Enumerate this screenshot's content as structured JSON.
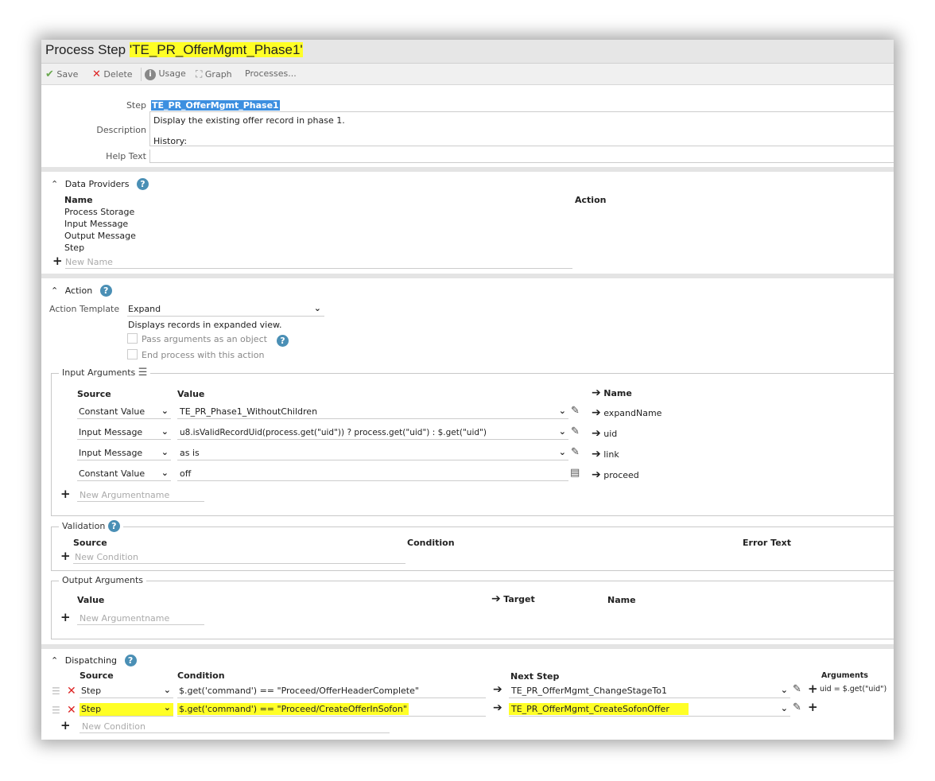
{
  "title": {
    "prefix": "Process Step",
    "name": "'TE_PR_OfferMgmt_Phase1'"
  },
  "toolbar": {
    "save": "Save",
    "delete": "Delete",
    "usage": "Usage",
    "graph": "Graph",
    "processes": "Processes..."
  },
  "step": {
    "step_label": "Step",
    "step_value": "TE_PR_OfferMgmt_Phase1",
    "description_label": "Description",
    "description_line1": "Display the existing offer record in phase 1.",
    "description_line2": "History:",
    "help_label": "Help Text"
  },
  "data_providers": {
    "title": "Data Providers",
    "col_name": "Name",
    "col_action": "Action",
    "items": [
      "Process Storage",
      "Input Message",
      "Output Message",
      "Step"
    ],
    "new_placeholder": "New Name"
  },
  "action": {
    "title": "Action",
    "template_label": "Action Template",
    "template_value": "Expand",
    "template_desc": "Displays records in expanded view.",
    "pass_args": "Pass arguments as an object",
    "end_process": "End process with this action"
  },
  "input_args": {
    "legend": "Input Arguments",
    "col_source": "Source",
    "col_value": "Value",
    "col_name": "Name",
    "rows": [
      {
        "source": "Constant Value",
        "value": "TE_PR_Phase1_WithoutChildren",
        "name": "expandName"
      },
      {
        "source": "Input Message",
        "value": "u8.isValidRecordUid(process.get(\"uid\")) ? process.get(\"uid\") : $.get(\"uid\")",
        "name": "uid"
      },
      {
        "source": "Input Message",
        "value": "as is",
        "name": "link"
      },
      {
        "source": "Constant Value",
        "value": "off",
        "name": "proceed"
      }
    ],
    "new_placeholder": "New Argumentname"
  },
  "validation": {
    "legend": "Validation",
    "col_source": "Source",
    "col_condition": "Condition",
    "col_error": "Error Text",
    "new_placeholder": "New Condition"
  },
  "output_args": {
    "legend": "Output Arguments",
    "col_value": "Value",
    "col_target": "Target",
    "col_name": "Name",
    "new_placeholder": "New Argumentname"
  },
  "dispatching": {
    "title": "Dispatching",
    "col_source": "Source",
    "col_condition": "Condition",
    "col_next": "Next Step",
    "col_args": "Arguments",
    "rows": [
      {
        "source": "Step",
        "condition": "$.get('command') == \"Proceed/OfferHeaderComplete\"",
        "next": "TE_PR_OfferMgmt_ChangeStageTo1",
        "args": "uid = $.get(\"uid\")"
      },
      {
        "source": "Step",
        "condition": "$.get('command') == \"Proceed/CreateOfferInSofon\"",
        "next": "TE_PR_OfferMgmt_CreateSofonOffer",
        "args": ""
      }
    ],
    "new_placeholder": "New Condition"
  },
  "colors": {
    "highlight": "#ffff26",
    "help_icon": "#4a8fb5",
    "delete_x": "#dd2222",
    "save_check": "#6aa84f"
  }
}
